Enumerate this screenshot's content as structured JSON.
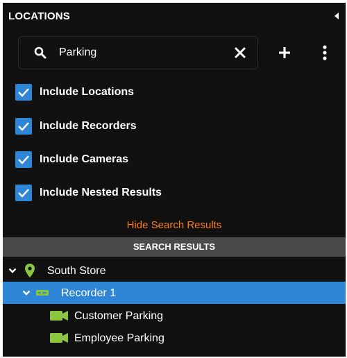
{
  "header": {
    "title": "LOCATIONS"
  },
  "search": {
    "value": "Parking",
    "placeholder": ""
  },
  "options": [
    {
      "label": "Include Locations",
      "checked": true
    },
    {
      "label": "Include Recorders",
      "checked": true
    },
    {
      "label": "Include Cameras",
      "checked": true
    },
    {
      "label": "Include Nested Results",
      "checked": true
    }
  ],
  "hide_link": "Hide Search Results",
  "results_title": "SEARCH RESULTS",
  "tree": {
    "location": {
      "label": "South Store",
      "icon": "map-pin-icon",
      "expanded": true
    },
    "recorder": {
      "label": "Recorder 1",
      "icon": "recorder-icon",
      "expanded": true,
      "selected": true
    },
    "cameras": [
      {
        "label": "Customer Parking",
        "icon": "camera-icon"
      },
      {
        "label": "Employee Parking",
        "icon": "camera-icon"
      }
    ]
  },
  "colors": {
    "panel_bg": "#111111",
    "accent_blue": "#2f86d6",
    "link_orange": "#ff7a1a",
    "icon_green": "#8cc63f",
    "results_bar": "#4a4a4a"
  }
}
